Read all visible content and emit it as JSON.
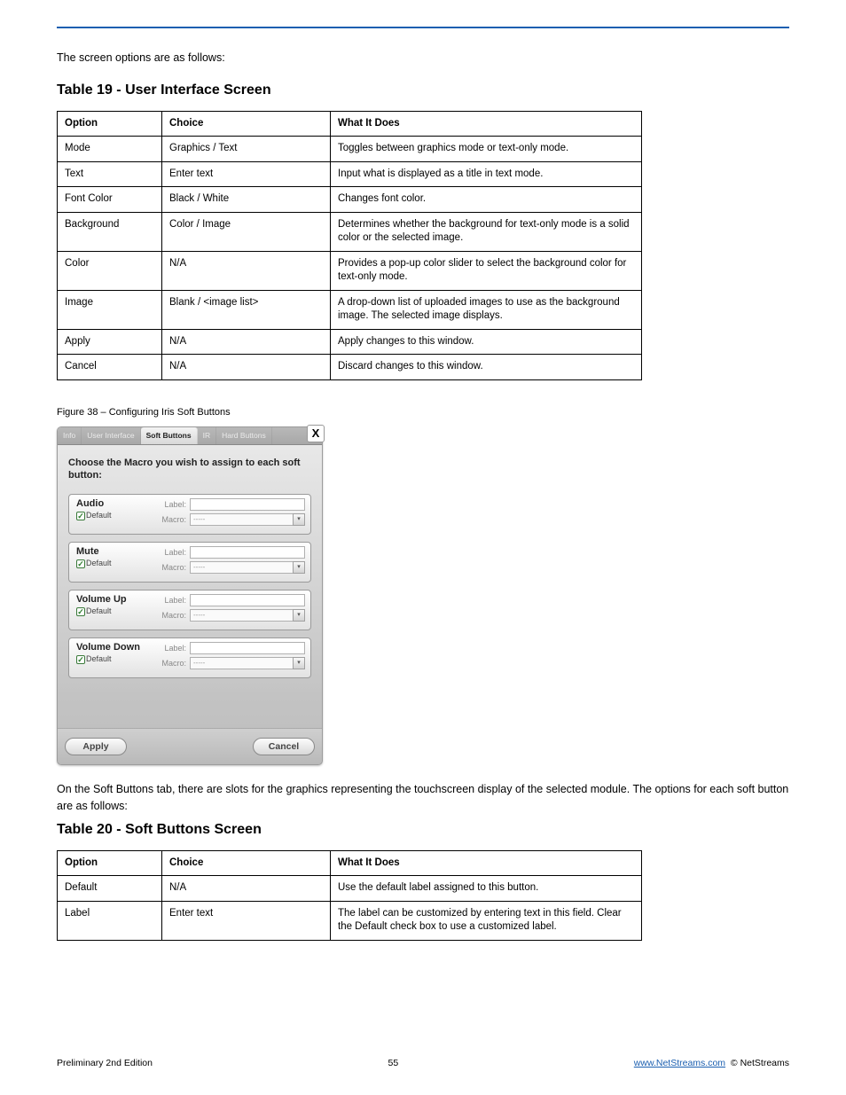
{
  "section": {
    "intro": "The screen options are as follows:",
    "heading1": "Table 19 - User Interface Screen",
    "table19": {
      "headers": [
        "Option",
        "Choice",
        "What It Does"
      ],
      "rows": [
        [
          "Mode",
          "Graphics / Text",
          "Toggles between graphics mode or text-only mode."
        ],
        [
          "Text",
          "Enter text",
          "Input what is displayed as a title in text mode."
        ],
        [
          "Font Color",
          "Black / White",
          "Changes font color."
        ],
        [
          "Background",
          "Color / Image",
          "Determines whether the background for text-only mode is a solid color or the selected image."
        ],
        [
          "Color",
          "N/A",
          "Provides a pop-up color slider to select the background color for text-only mode."
        ],
        [
          "Image",
          "Blank / <image list>",
          "A drop-down list of uploaded images to use as the background image. The selected image displays."
        ],
        [
          "Apply",
          "N/A",
          "Apply changes to this window."
        ],
        [
          "Cancel",
          "N/A",
          "Discard changes to this window."
        ]
      ]
    },
    "fig_caption": "Figure 38 – Configuring Iris Soft Buttons",
    "post_fig": "On the Soft Buttons tab, there are slots for the graphics representing the touchscreen display of the selected module. The options for each soft button are as follows:",
    "heading2": "Table 20 - Soft Buttons Screen",
    "table20": {
      "headers": [
        "Option",
        "Choice",
        "What It Does"
      ],
      "rows": [
        [
          "Default",
          "N/A",
          "Use the default label assigned to this button."
        ],
        [
          "Label",
          "Enter text",
          "The label can be customized by entering text in this field. Clear the Default check box to use a customized label."
        ]
      ]
    }
  },
  "dialog": {
    "tabs": [
      "Info",
      "User Interface",
      "Soft Buttons",
      "IR",
      "Hard Buttons"
    ],
    "active_tab": "Soft Buttons",
    "prompt": "Choose the Macro you wish to assign to each soft button:",
    "rows": [
      {
        "name": "Audio",
        "default_label": "Default",
        "label_caption": "Label:",
        "macro_caption": "Macro:",
        "macro_value": "-----"
      },
      {
        "name": "Mute",
        "default_label": "Default",
        "label_caption": "Label:",
        "macro_caption": "Macro:",
        "macro_value": "-----"
      },
      {
        "name": "Volume Up",
        "default_label": "Default",
        "label_caption": "Label:",
        "macro_caption": "Macro:",
        "macro_value": "-----"
      },
      {
        "name": "Volume Down",
        "default_label": "Default",
        "label_caption": "Label:",
        "macro_caption": "Macro:",
        "macro_value": "-----"
      }
    ],
    "apply": "Apply",
    "cancel": "Cancel",
    "close": "X"
  },
  "footer": {
    "edition": "Preliminary 2nd Edition",
    "page": "55",
    "link_label": "www.NetStreams.com",
    "company": "NetStreams"
  }
}
